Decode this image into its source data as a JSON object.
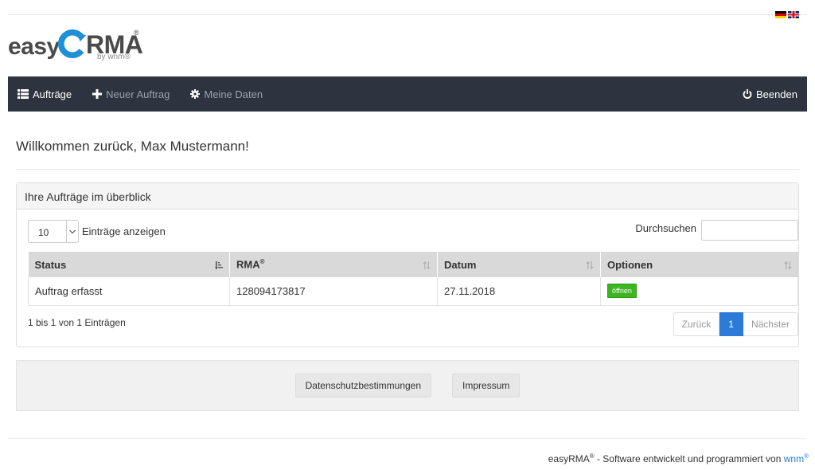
{
  "brand": {
    "easy": "easy",
    "rma": "RMA",
    "reg": "®",
    "by": "by wnm®"
  },
  "nav": {
    "orders": "Aufträge",
    "new_order": "Neuer Auftrag",
    "my_data": "Meine Daten",
    "logout": "Beenden"
  },
  "welcome": "Willkommen zurück, Max Mustermann!",
  "panel": {
    "title": "Ihre Aufträge im überblick",
    "page_length": "10",
    "page_length_label": "Einträge anzeigen",
    "search_label": "Durchsuchen",
    "search_value": "",
    "columns": {
      "status": "Status",
      "rma": "RMA",
      "rma_reg": "®",
      "date": "Datum",
      "options": "Optionen"
    },
    "rows": [
      {
        "status": "Auftrag erfasst",
        "rma": "128094173817",
        "date": "27.11.2018",
        "action": "öffnen"
      }
    ],
    "info": "1 bis 1 von 1 Einträgen",
    "pagination": {
      "prev": "Zurück",
      "current": "1",
      "next": "Nächster"
    }
  },
  "footer": {
    "privacy": "Datenschutzbestimmungen",
    "imprint": "Impressum",
    "credit_brand": "easyRMA",
    "credit_reg": "®",
    "credit_text": " - Software entwickelt und programmiert von ",
    "credit_link": "wnm",
    "credit_link_reg": "®"
  },
  "colors": {
    "navbar": "#2d3440",
    "accent_blue": "#2b7bd8",
    "success_green": "#3cb521"
  },
  "icons": [
    "list-icon",
    "plus-icon",
    "gear-icon",
    "power-icon",
    "sort-asc-icon",
    "sort-icon",
    "chevron-down-icon",
    "flag-de-icon",
    "flag-gb-icon"
  ]
}
